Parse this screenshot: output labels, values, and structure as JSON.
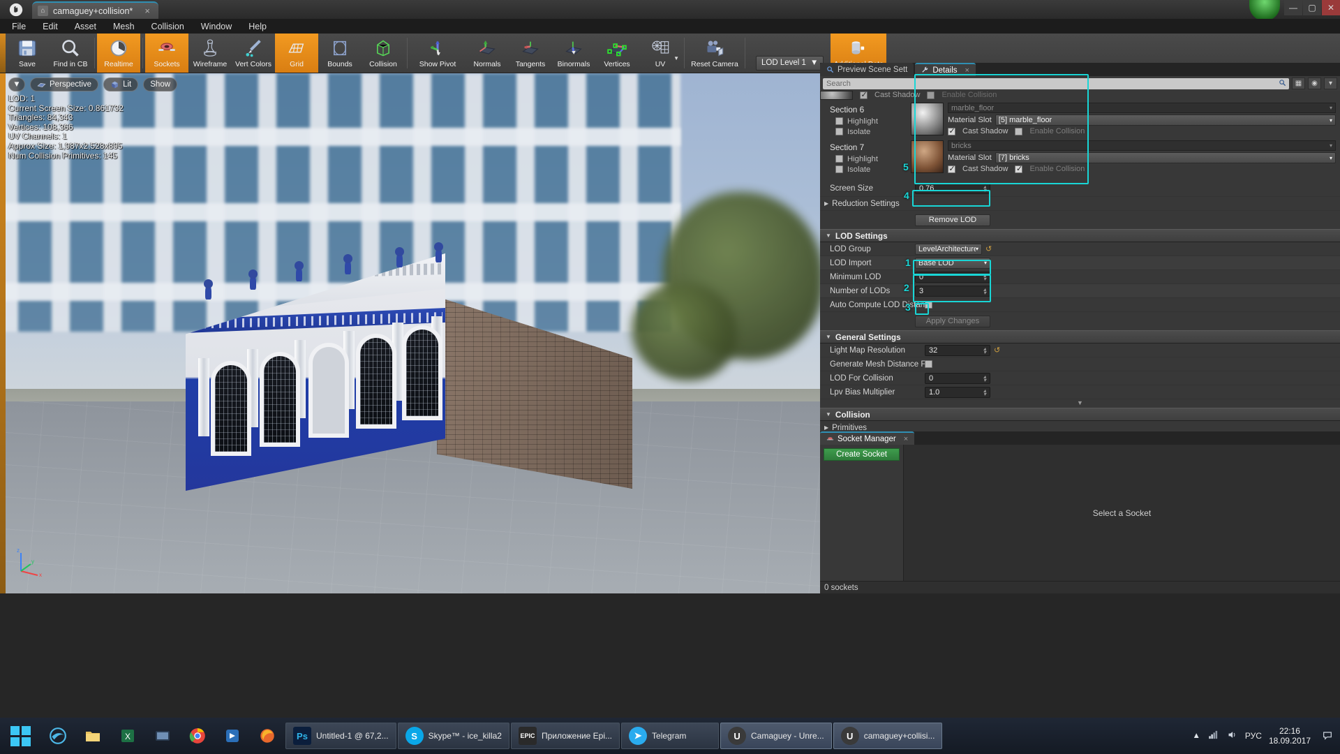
{
  "titlebar": {
    "logo": "ue-logo",
    "document_tab": "camaguey+collision*",
    "close_glyph": "×",
    "minimize": "—",
    "maximize": "▢",
    "close": "✕"
  },
  "menubar": {
    "items": [
      "File",
      "Edit",
      "Asset",
      "Mesh",
      "Collision",
      "Window",
      "Help"
    ]
  },
  "toolbar": {
    "buttons": [
      {
        "label": "Save",
        "icon": "floppy-disk-icon",
        "active": false
      },
      {
        "label": "Find in CB",
        "icon": "magnifier-icon",
        "active": false
      },
      {
        "label": "Realtime",
        "icon": "clock-icon",
        "active": true
      },
      {
        "label": "Sockets",
        "icon": "socket-icon",
        "active": true
      },
      {
        "label": "Wireframe",
        "icon": "pawn-wireframe-icon",
        "active": false
      },
      {
        "label": "Vert Colors",
        "icon": "paint-brush-icon",
        "active": false
      },
      {
        "label": "Grid",
        "icon": "grid-icon",
        "active": true
      },
      {
        "label": "Bounds",
        "icon": "bounds-box-icon",
        "active": false
      },
      {
        "label": "Collision",
        "icon": "collision-icon",
        "active": false
      },
      {
        "label": "Show Pivot",
        "icon": "pivot-axis-icon",
        "active": false
      },
      {
        "label": "Normals",
        "icon": "normals-icon",
        "active": false
      },
      {
        "label": "Tangents",
        "icon": "tangents-icon",
        "active": false
      },
      {
        "label": "Binormals",
        "icon": "binormals-icon",
        "active": false
      },
      {
        "label": "Vertices",
        "icon": "vertices-icon",
        "active": false
      },
      {
        "label": "UV",
        "icon": "uv-icon",
        "active": false
      },
      {
        "label": "Reset Camera",
        "icon": "camera-icon",
        "active": false
      }
    ],
    "lod_level": "LOD Level 1",
    "additional_data": "Additional Data"
  },
  "viewport": {
    "view_mode_caret": "▼",
    "perspective": "Perspective",
    "lit": "Lit",
    "show": "Show",
    "stats": [
      "LOD:  1",
      "Current Screen Size:  0.861732",
      "Triangles:  84,343",
      "Vertices:  108,366",
      "UV Channels:  1",
      "Approx Size: 1,987x2,528x895",
      "Num Collision Primitives:  145"
    ],
    "axis_x": "x",
    "axis_y": "y",
    "axis_z": "z"
  },
  "details_panel": {
    "tabs": [
      {
        "label": "Preview Scene Sett",
        "icon": "magnifier-icon",
        "active": false
      },
      {
        "label": "Details",
        "icon": "wrench-icon",
        "active": true,
        "close": "×"
      }
    ],
    "search_placeholder": "Search",
    "search_value": "",
    "sections": [
      {
        "name": "Section 6",
        "highlight_label": "Highlight",
        "highlight_checked": false,
        "isolate_label": "Isolate",
        "isolate_checked": false,
        "material_name": "marble_floor",
        "material_slot_label": "Material Slot",
        "material_slot_value": "[5] marble_floor",
        "cast_shadow_label": "Cast Shadow",
        "cast_shadow_checked": true,
        "enable_collision_label": "Enable Collision",
        "enable_collision_checked": false,
        "thumb": "sphere-checker-icon"
      },
      {
        "name": "Section 7",
        "highlight_label": "Highlight",
        "highlight_checked": false,
        "isolate_label": "Isolate",
        "isolate_checked": false,
        "material_name": "bricks",
        "material_slot_label": "Material Slot",
        "material_slot_value": "[7] bricks",
        "cast_shadow_label": "Cast Shadow",
        "cast_shadow_checked": true,
        "enable_collision_label": "Enable Collision",
        "enable_collision_checked": true,
        "thumb": "sphere-brick-icon"
      }
    ],
    "screen_size_label": "Screen Size",
    "screen_size_value": "0.76",
    "reduction_settings_label": "Reduction Settings",
    "remove_lod_label": "Remove LOD",
    "lod_settings": {
      "title": "LOD Settings",
      "lod_group_label": "LOD Group",
      "lod_group_value": "LevelArchitecture",
      "lod_import_label": "LOD Import",
      "lod_import_value": "Base LOD",
      "minimum_lod_label": "Minimum LOD",
      "minimum_lod_value": "0",
      "number_of_lods_label": "Number of LODs",
      "number_of_lods_value": "3",
      "auto_compute_label": "Auto Compute LOD Distance",
      "auto_compute_checked": false,
      "apply_changes_label": "Apply Changes"
    },
    "general_settings": {
      "title": "General Settings",
      "light_map_resolution_label": "Light Map Resolution",
      "light_map_resolution_value": "32",
      "generate_mesh_distance_label": "Generate Mesh Distance Fiel",
      "generate_mesh_distance_checked": false,
      "lod_for_collision_label": "LOD For Collision",
      "lod_for_collision_value": "0",
      "lpv_bias_label": "Lpv Bias Multiplier",
      "lpv_bias_value": "1.0"
    },
    "collision": {
      "title": "Collision",
      "primitives_label": "Primitives"
    },
    "annotations": [
      "1",
      "2",
      "3",
      "4",
      "5"
    ]
  },
  "socket_manager": {
    "tab_label": "Socket Manager",
    "tab_close": "×",
    "create_socket_label": "Create Socket",
    "empty_message": "Select a Socket",
    "footer": "0 sockets"
  },
  "taskbar": {
    "start_icon": "windows-start-icon",
    "quick_icons": [
      "edge-icon",
      "explorer-icon",
      "excel-icon",
      "vlc-icon",
      "chrome-icon",
      "store-icon",
      "firefox-icon"
    ],
    "tasks": [
      {
        "label": "Untitled-1 @ 67,2...",
        "icon": "Ps",
        "icon_name": "photoshop-icon",
        "color": "#0b1e3c",
        "text_color": "#2fb3e8",
        "active": false
      },
      {
        "label": "Skype™ - ice_killa2",
        "icon": "S",
        "icon_name": "skype-icon",
        "color": "#0aa7e8",
        "text_color": "#ffffff",
        "active": false
      },
      {
        "label": "Приложение Epi...",
        "icon": "E",
        "icon_name": "epic-games-icon",
        "color": "#2a2a2a",
        "text_color": "#ffffff",
        "active": false
      },
      {
        "label": "Telegram",
        "icon": "T",
        "icon_name": "telegram-icon",
        "color": "#2aabee",
        "text_color": "#ffffff",
        "active": false
      },
      {
        "label": "Camaguey - Unre...",
        "icon": "U",
        "icon_name": "unreal-engine-icon",
        "color": "#3a3a3a",
        "text_color": "#ffffff",
        "active": true
      },
      {
        "label": "camaguey+collisi...",
        "icon": "U",
        "icon_name": "unreal-engine-icon",
        "color": "#3a3a3a",
        "text_color": "#ffffff",
        "active": true
      }
    ],
    "tray": {
      "caret": "▲",
      "network_icon": "network-icon",
      "volume_icon": "volume-icon",
      "language": "РУС",
      "time": "22:16",
      "date": "18.09.2017",
      "notification_icon": "notification-icon"
    }
  }
}
